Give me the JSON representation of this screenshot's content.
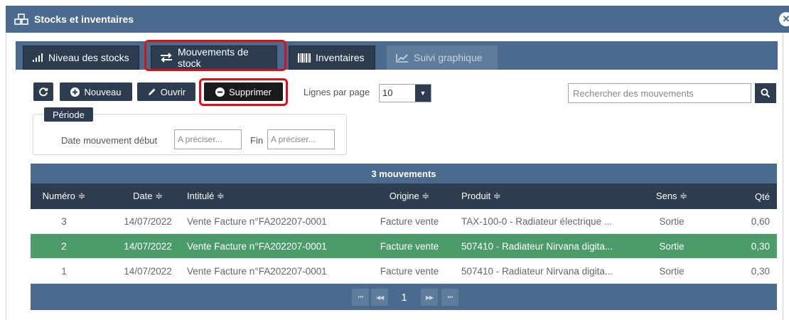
{
  "window": {
    "title": "Stocks et inventaires"
  },
  "tabs": [
    {
      "label": "Niveau des stocks"
    },
    {
      "label": "Mouvements de stock"
    },
    {
      "label": "Inventaires"
    },
    {
      "label": "Suivi graphique"
    }
  ],
  "toolbar": {
    "nouveau_label": "Nouveau",
    "ouvrir_label": "Ouvrir",
    "supprimer_label": "Supprimer",
    "lines_per_page_label": "Lignes par page",
    "lines_per_page_value": "10",
    "search_placeholder": "Rechercher des mouvements"
  },
  "periode": {
    "legend": "Période",
    "debut_label": "Date mouvement début",
    "debut_placeholder": "A préciser...",
    "fin_label": "Fin",
    "fin_placeholder": "A préciser..."
  },
  "table": {
    "count_label": "3 mouvements",
    "columns": [
      "Numéro ≑",
      "Date ≑",
      "Intitulé ≑",
      "Origine ≑",
      "Produit ≑",
      "Sens ≑",
      "Qté"
    ],
    "rows": [
      {
        "numero": "3",
        "date": "14/07/2022",
        "intitule": "Vente Facture n°FA202207-0001",
        "origine": "Facture vente",
        "produit": "TAX-100-0 - Radiateur électrique ...",
        "sens": "Sortie",
        "qte": "0,60"
      },
      {
        "numero": "2",
        "date": "14/07/2022",
        "intitule": "Vente Facture n°FA202207-0001",
        "origine": "Facture vente",
        "produit": "507410 - Radiateur Nirvana digita...",
        "sens": "Sortie",
        "qte": "0,30"
      },
      {
        "numero": "1",
        "date": "14/07/2022",
        "intitule": "Vente Facture n°FA202207-0001",
        "origine": "Facture vente",
        "produit": "507410 - Radiateur Nirvana digita...",
        "sens": "Sortie",
        "qte": "0,30"
      }
    ],
    "selected_row_index": 1
  },
  "pagination": {
    "first": "⏮",
    "prev": "◀◀",
    "current_page": "1",
    "next": "▶▶",
    "last": "⏭"
  },
  "colors": {
    "header_blue": "#4a6a8e",
    "dark_navy": "#2d3c4e",
    "selected_green": "#4c9b6a",
    "highlight_red": "#d4131b"
  }
}
